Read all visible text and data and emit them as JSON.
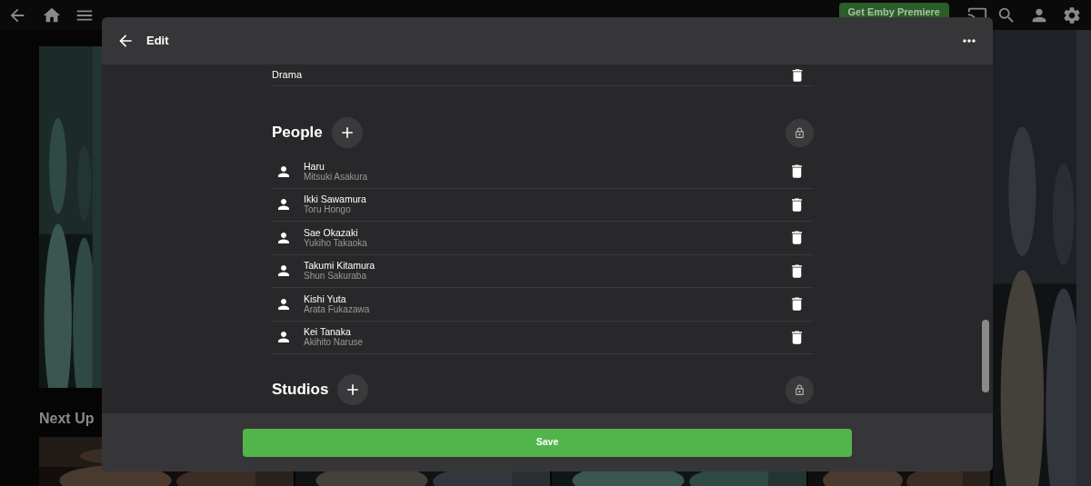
{
  "top_bar": {
    "premiere_button": "Get Emby Premiere"
  },
  "next_up": {
    "title": "Next Up"
  },
  "dialog": {
    "title": "Edit",
    "genres": [
      {
        "name": "Drama"
      }
    ],
    "people": {
      "title": "People",
      "items": [
        {
          "name": "Haru",
          "role": "Mitsuki Asakura"
        },
        {
          "name": "Ikki Sawamura",
          "role": "Toru Hongo"
        },
        {
          "name": "Sae Okazaki",
          "role": "Yukiho Takaoka"
        },
        {
          "name": "Takumi Kitamura",
          "role": "Shun Sakuraba"
        },
        {
          "name": "Kishi Yuta",
          "role": "Arata Fukazawa"
        },
        {
          "name": "Kei Tanaka",
          "role": "Akihito Naruse"
        }
      ]
    },
    "studios": {
      "title": "Studios"
    },
    "save_button": "Save"
  }
}
